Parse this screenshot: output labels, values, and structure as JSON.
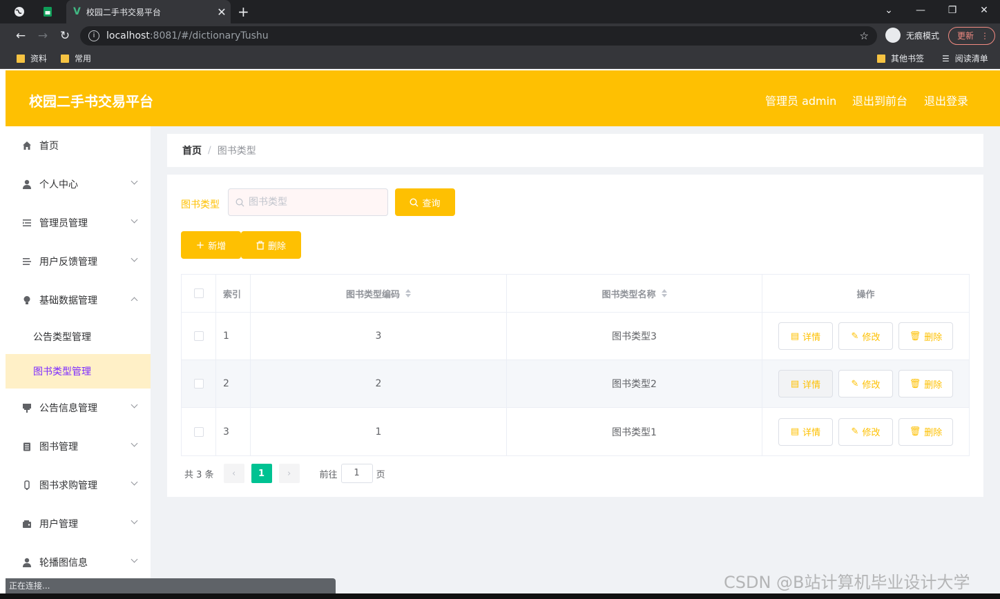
{
  "browser": {
    "tab_title": "校园二手书交易平台",
    "url_host": "localhost",
    "url_rest": ":8081/#/dictionaryTushu",
    "incognito_label": "无痕模式",
    "update_label": "更新",
    "bookmarks": [
      "资料",
      "常用"
    ],
    "other_bookmarks": "其他书签",
    "reading_list": "阅读清单",
    "status_text": "正在连接..."
  },
  "header": {
    "title": "校园二手书交易平台",
    "admin_label": "管理员 admin",
    "to_front_label": "退出到前台",
    "logout_label": "退出登录"
  },
  "sidebar": {
    "items": [
      {
        "label": "首页",
        "icon": "home-icon"
      },
      {
        "label": "个人中心",
        "icon": "user-icon"
      },
      {
        "label": "管理员管理",
        "icon": "list-icon"
      },
      {
        "label": "用户反馈管理",
        "icon": "feedback-icon"
      },
      {
        "label": "基础数据管理",
        "icon": "bulb-icon"
      },
      {
        "label": "公告类型管理"
      },
      {
        "label": "图书类型管理"
      },
      {
        "label": "公告信息管理",
        "icon": "notice-icon"
      },
      {
        "label": "图书管理",
        "icon": "book-icon"
      },
      {
        "label": "图书求购管理",
        "icon": "purchase-icon"
      },
      {
        "label": "用户管理",
        "icon": "wallet-icon"
      },
      {
        "label": "轮播图信息",
        "icon": "person-icon"
      }
    ]
  },
  "breadcrumb": {
    "home": "首页",
    "sep": "/",
    "current": "图书类型"
  },
  "search": {
    "label": "图书类型",
    "placeholder": "图书类型",
    "button": "查询"
  },
  "actions": {
    "add": "新增",
    "delete": "删除"
  },
  "table": {
    "headers": [
      "索引",
      "图书类型编码",
      "图书类型名称",
      "操作"
    ],
    "rows": [
      {
        "index": "1",
        "code": "3",
        "name": "图书类型3"
      },
      {
        "index": "2",
        "code": "2",
        "name": "图书类型2"
      },
      {
        "index": "3",
        "code": "1",
        "name": "图书类型1"
      }
    ],
    "op_labels": {
      "detail": "详情",
      "edit": "修改",
      "delete": "删除"
    }
  },
  "pagination": {
    "total": "共 3 条",
    "current": "1",
    "goto_label": "前往",
    "goto_value": "1",
    "page_suffix": "页"
  },
  "watermark": "CSDN @B站计算机毕业设计大学",
  "colors": {
    "brand": "#fec002",
    "active_sub_bg": "#fff0c7",
    "active_sub_text": "#7c2aff",
    "pager_active": "#00c292"
  }
}
